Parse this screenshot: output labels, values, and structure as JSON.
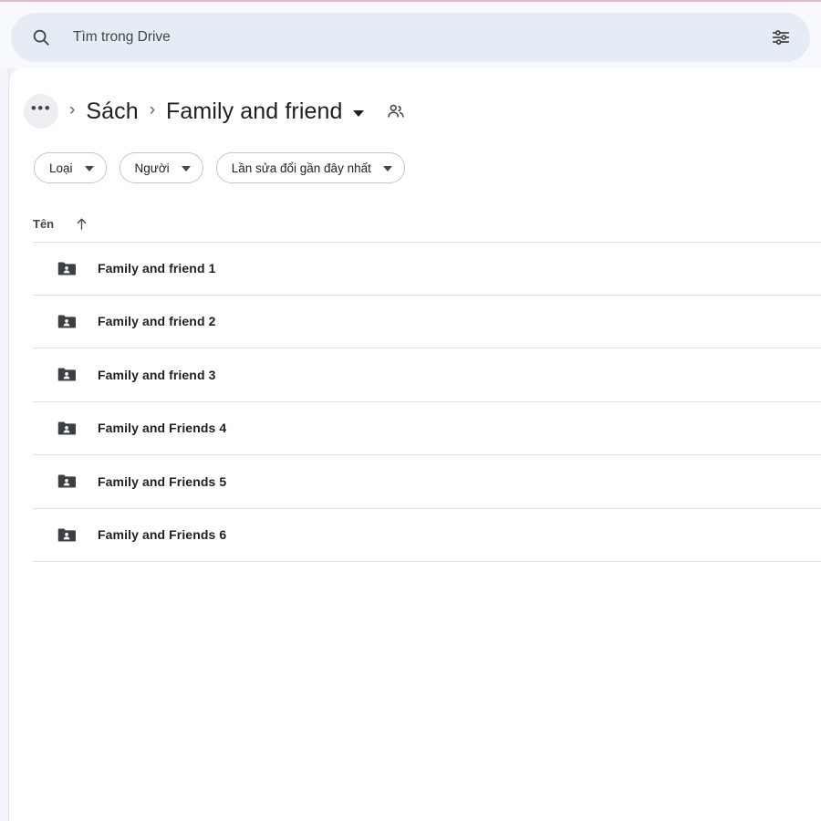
{
  "theme": {
    "accent_line": "#e0b9cf",
    "search_bg": "#e6ecf6",
    "panel_bg": "#ffffff",
    "page_bg": "#eef1f7",
    "text_primary": "#1f1f1f",
    "text_secondary": "#444746",
    "divider": "#dfe1e5"
  },
  "search": {
    "placeholder": "Tìm trong Drive",
    "value": "",
    "search_icon": "search-icon",
    "tune_icon": "tune-icon"
  },
  "breadcrumb": {
    "more_label": "•••",
    "more_icon": "more-horizontal-icon",
    "separator": "›",
    "items": [
      {
        "label": "Sách"
      }
    ],
    "current": "Family and friend",
    "caret_icon": "chevron-down-icon",
    "shared_icon": "people-shared-icon"
  },
  "filters": {
    "chips": [
      {
        "label": "Loại",
        "caret_icon": "chevron-down-icon"
      },
      {
        "label": "Người",
        "caret_icon": "chevron-down-icon"
      },
      {
        "label": "Lần sửa đổi gần đây nhất",
        "caret_icon": "chevron-down-icon"
      }
    ]
  },
  "list": {
    "columns": [
      {
        "label": "Tên",
        "sort": "asc",
        "sort_icon": "arrow-up-icon"
      }
    ],
    "rows": [
      {
        "name": "Family and friend 1",
        "icon": "shared-folder-icon"
      },
      {
        "name": "Family and friend 2",
        "icon": "shared-folder-icon"
      },
      {
        "name": "Family and friend 3",
        "icon": "shared-folder-icon"
      },
      {
        "name": "Family and Friends 4",
        "icon": "shared-folder-icon"
      },
      {
        "name": "Family and Friends 5",
        "icon": "shared-folder-icon"
      },
      {
        "name": "Family and Friends 6",
        "icon": "shared-folder-icon"
      }
    ]
  }
}
